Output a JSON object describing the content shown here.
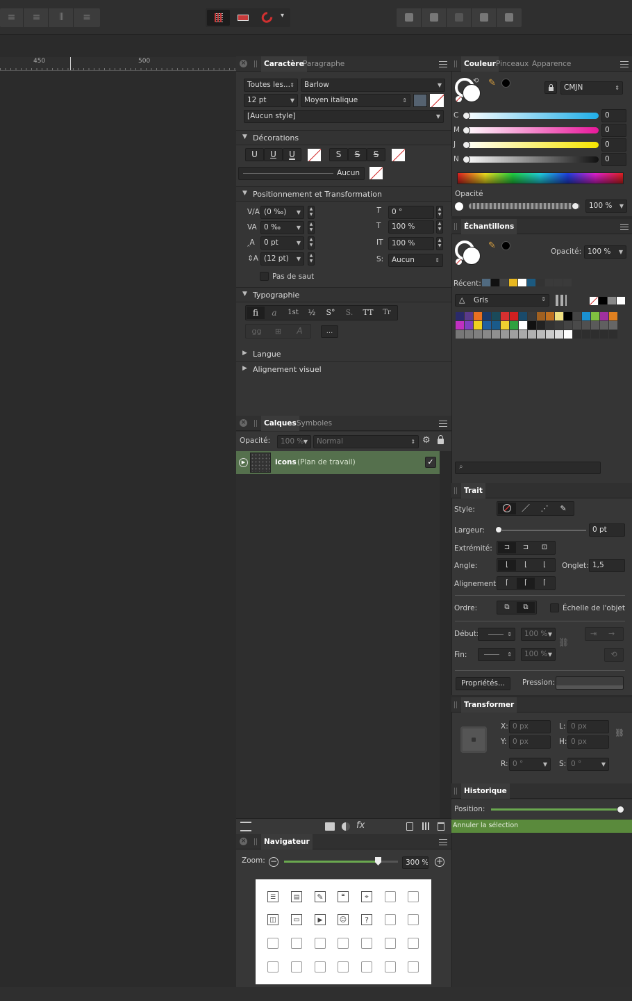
{
  "toolbar": {
    "snap_arrow": "▾"
  },
  "ruler": {
    "ticks": [
      "450",
      "500"
    ]
  },
  "char_panel": {
    "tabs": [
      "Caractère",
      "Paragraphe"
    ],
    "font_collection": "Toutes les...",
    "font_family": "Barlow",
    "font_size": "12 pt",
    "font_style": "Moyen italique",
    "char_style": "[Aucun style]",
    "decorations": {
      "title": "Décorations",
      "u1": "U",
      "u2": "U",
      "u3": "U",
      "s1": "S",
      "s2": "S",
      "s3": "S",
      "line_value": "Aucun"
    },
    "position": {
      "title": "Positionnement et Transformation",
      "tracking": "(0 ‰)",
      "kerning": "0 ‰",
      "baseline": "0 pt",
      "leading": "(12 pt)",
      "skew": "0 °",
      "h_scale": "100 %",
      "v_scale": "100 %",
      "shear": "Aucun",
      "no_break_label": "Pas de saut"
    },
    "typography": {
      "title": "Typographie",
      "buttons": [
        "fi",
        "a",
        "1st",
        "½",
        "S°",
        "S.",
        "TT",
        "Tr",
        "gg",
        "⊞",
        "A",
        "..."
      ]
    },
    "langue": "Langue",
    "alignement": "Alignement visuel"
  },
  "color_panel": {
    "tabs": [
      "Couleur",
      "Pinceaux",
      "Apparence"
    ],
    "mode": "CMJN",
    "channels": [
      {
        "name": "C",
        "value": "0"
      },
      {
        "name": "M",
        "value": "0"
      },
      {
        "name": "J",
        "value": "0"
      },
      {
        "name": "N",
        "value": "0"
      }
    ],
    "opacity_label": "Opacité",
    "opacity_value": "100 %"
  },
  "swatches_panel": {
    "title": "Échantillons",
    "opacity_label": "Opacité:",
    "opacity_value": "100 %",
    "recent_label": "Récent:",
    "palette": "Gris",
    "recent_colors": [
      "#506a80",
      "#111111",
      "#444444",
      "#e8b820",
      "#ffffff",
      "#1c5a80",
      "#333333",
      "#3a3a3a",
      "#3a3a3a",
      "#3a3a3a"
    ]
  },
  "layers_panel": {
    "tabs": [
      "Calques",
      "Symboles"
    ],
    "opacity_label": "Opacité:",
    "opacity_value": "100 %",
    "blend_mode": "Normal",
    "layer_name": "icons",
    "layer_sub": "(Plan de travail)"
  },
  "navigator": {
    "title": "Navigateur",
    "zoom_label": "Zoom:",
    "zoom_value": "300 %"
  },
  "stroke_panel": {
    "title": "Trait",
    "style_label": "Style:",
    "width_label": "Largeur:",
    "width_value": "0 pt",
    "cap_label": "Extrémité:",
    "join_label": "Angle:",
    "miter_label": "Onglet:",
    "miter_value": "1,5",
    "align_label": "Alignement:",
    "order_label": "Ordre:",
    "scale_label": "Échelle de l'objet",
    "start_label": "Début:",
    "start_value": "100 %",
    "end_label": "Fin:",
    "end_value": "100 %",
    "properties_button": "Propriétés...",
    "pressure_label": "Pression:"
  },
  "transform_panel": {
    "title": "Transformer",
    "x_label": "X:",
    "x_value": "0 px",
    "y_label": "Y:",
    "y_value": "0 px",
    "w_label": "L:",
    "w_value": "0 px",
    "h_label": "H:",
    "h_value": "0 px",
    "r_label": "R:",
    "r_value": "0 °",
    "s_label": "S:",
    "s_value": "0 °"
  },
  "history_panel": {
    "title": "Historique",
    "position_label": "Position:",
    "entry": "Annuler la sélection"
  },
  "colors": {
    "accent_green": "#5a8a3c",
    "layer_selected": "#55704d"
  }
}
